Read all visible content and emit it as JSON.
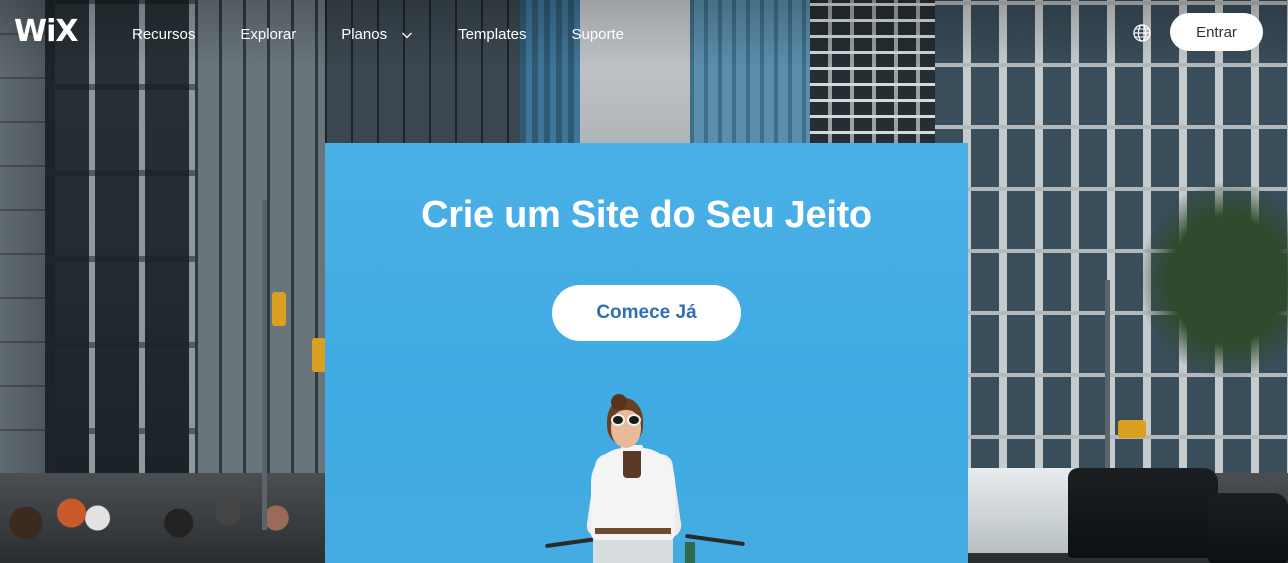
{
  "brand": {
    "logo_text": "WiX"
  },
  "nav": {
    "items": [
      {
        "label": "Recursos",
        "has_dropdown": false
      },
      {
        "label": "Explorar",
        "has_dropdown": false
      },
      {
        "label": "Planos",
        "has_dropdown": true
      },
      {
        "label": "Templates",
        "has_dropdown": false
      },
      {
        "label": "Suporte",
        "has_dropdown": false
      }
    ],
    "language_icon": "globe-icon",
    "login_label": "Entrar"
  },
  "hero": {
    "title": "Crie um Site do Seu Jeito",
    "cta_label": "Comece Já",
    "background_color": "#3faae3",
    "cta_text_color": "#2e6fb6"
  }
}
